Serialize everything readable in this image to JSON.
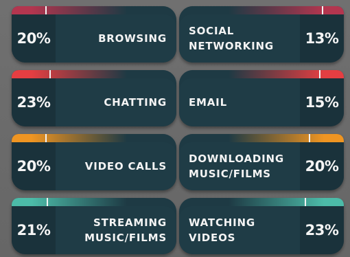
{
  "accents": {
    "crimson": "#b3364f",
    "red": "#e43e42",
    "orange": "#ef9522",
    "teal": "#4cbba8"
  },
  "rows": [
    {
      "left": {
        "label": "BROWSING",
        "percent": "20%",
        "accent": "#b3364f"
      },
      "right": {
        "label": "SOCIAL\nNETWORKING",
        "percent": "13%",
        "accent": "#b3364f"
      }
    },
    {
      "left": {
        "label": "CHATTING",
        "percent": "23%",
        "accent": "#e43e42"
      },
      "right": {
        "label": "EMAIL",
        "percent": "15%",
        "accent": "#e43e42"
      }
    },
    {
      "left": {
        "label": "VIDEO CALLS",
        "percent": "20%",
        "accent": "#ef9522"
      },
      "right": {
        "label": "DOWNLOADING\nMUSIC/FILMS",
        "percent": "20%",
        "accent": "#ef9522"
      }
    },
    {
      "left": {
        "label": "STREAMING\nMUSIC/FILMS",
        "percent": "21%",
        "accent": "#4cbba8"
      },
      "right": {
        "label": "WATCHING\nVIDEOS",
        "percent": "23%",
        "accent": "#4cbba8"
      }
    }
  ]
}
